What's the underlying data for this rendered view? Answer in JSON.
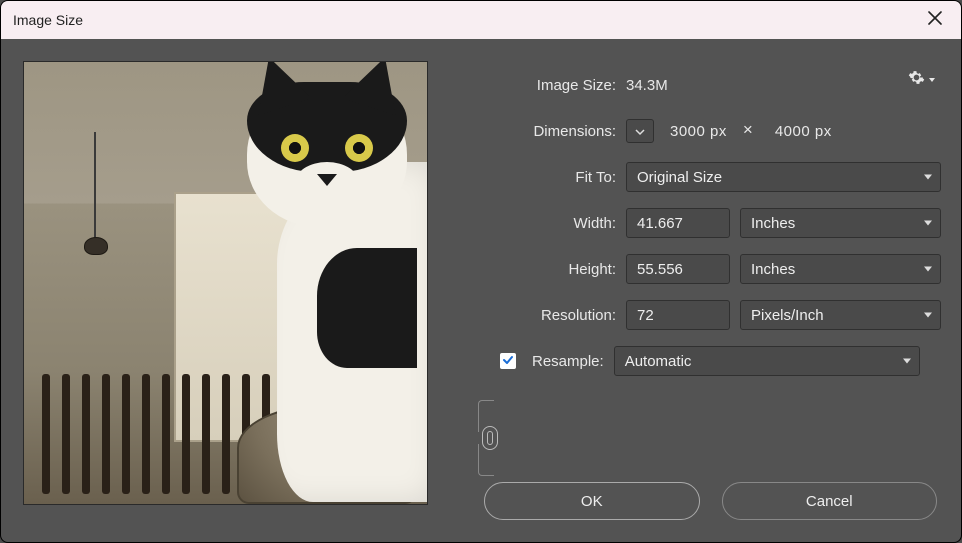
{
  "title": "Image Size",
  "labels": {
    "image_size": "Image Size:",
    "dimensions": "Dimensions:",
    "fit_to": "Fit To:",
    "width": "Width:",
    "height": "Height:",
    "resolution": "Resolution:",
    "resample": "Resample:"
  },
  "values": {
    "image_size": "34.3M",
    "dim_w": "3000 px",
    "dim_h": "4000 px",
    "fit_to": "Original Size",
    "width": "41.667",
    "height": "55.556",
    "width_unit": "Inches",
    "height_unit": "Inches",
    "resolution": "72",
    "resolution_unit": "Pixels/Inch",
    "resample": "Automatic",
    "resample_checked": true,
    "aspect_locked": true
  },
  "buttons": {
    "ok": "OK",
    "cancel": "Cancel"
  },
  "icons": {
    "close": "close-icon",
    "gear": "gear-icon",
    "chevron_down": "chevron-down-icon",
    "link": "link-icon",
    "check": "checkmark-icon"
  }
}
